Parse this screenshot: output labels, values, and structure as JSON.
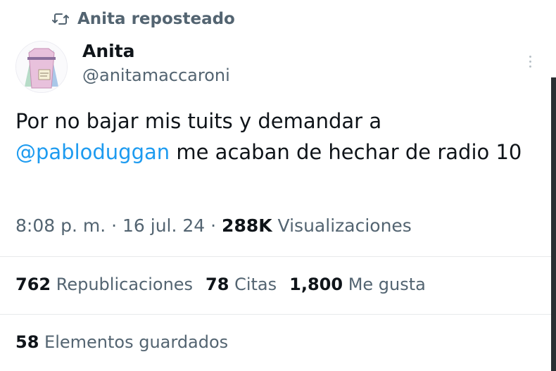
{
  "repost": {
    "icon": "repost-icon",
    "label": "Anita reposteado"
  },
  "author": {
    "name": "Anita",
    "handle": "@anitamaccaroni",
    "avatar_icon": "avatar-illustration"
  },
  "tweet": {
    "text_before": "Por no bajar mis tuits y demandar a ",
    "mention": "@pabloduggan",
    "text_after": " me acaban de hechar de radio 10"
  },
  "meta": {
    "time": "8:08 p. m.",
    "sep1": " · ",
    "date": "16 jul. 24",
    "sep2": " · ",
    "views_count": "288K",
    "views_label": " Visualizaciones"
  },
  "stats": {
    "reposts_count": "762",
    "reposts_label": " Republicaciones",
    "quotes_count": "78",
    "quotes_label": " Citas",
    "likes_count": "1,800",
    "likes_label": " Me gusta"
  },
  "bookmarks": {
    "count": "58",
    "label": " Elementos guardados"
  },
  "colors": {
    "text": "#0f1419",
    "secondary": "#536471",
    "link": "#1d9bf0",
    "divider": "#e7e9eb"
  }
}
